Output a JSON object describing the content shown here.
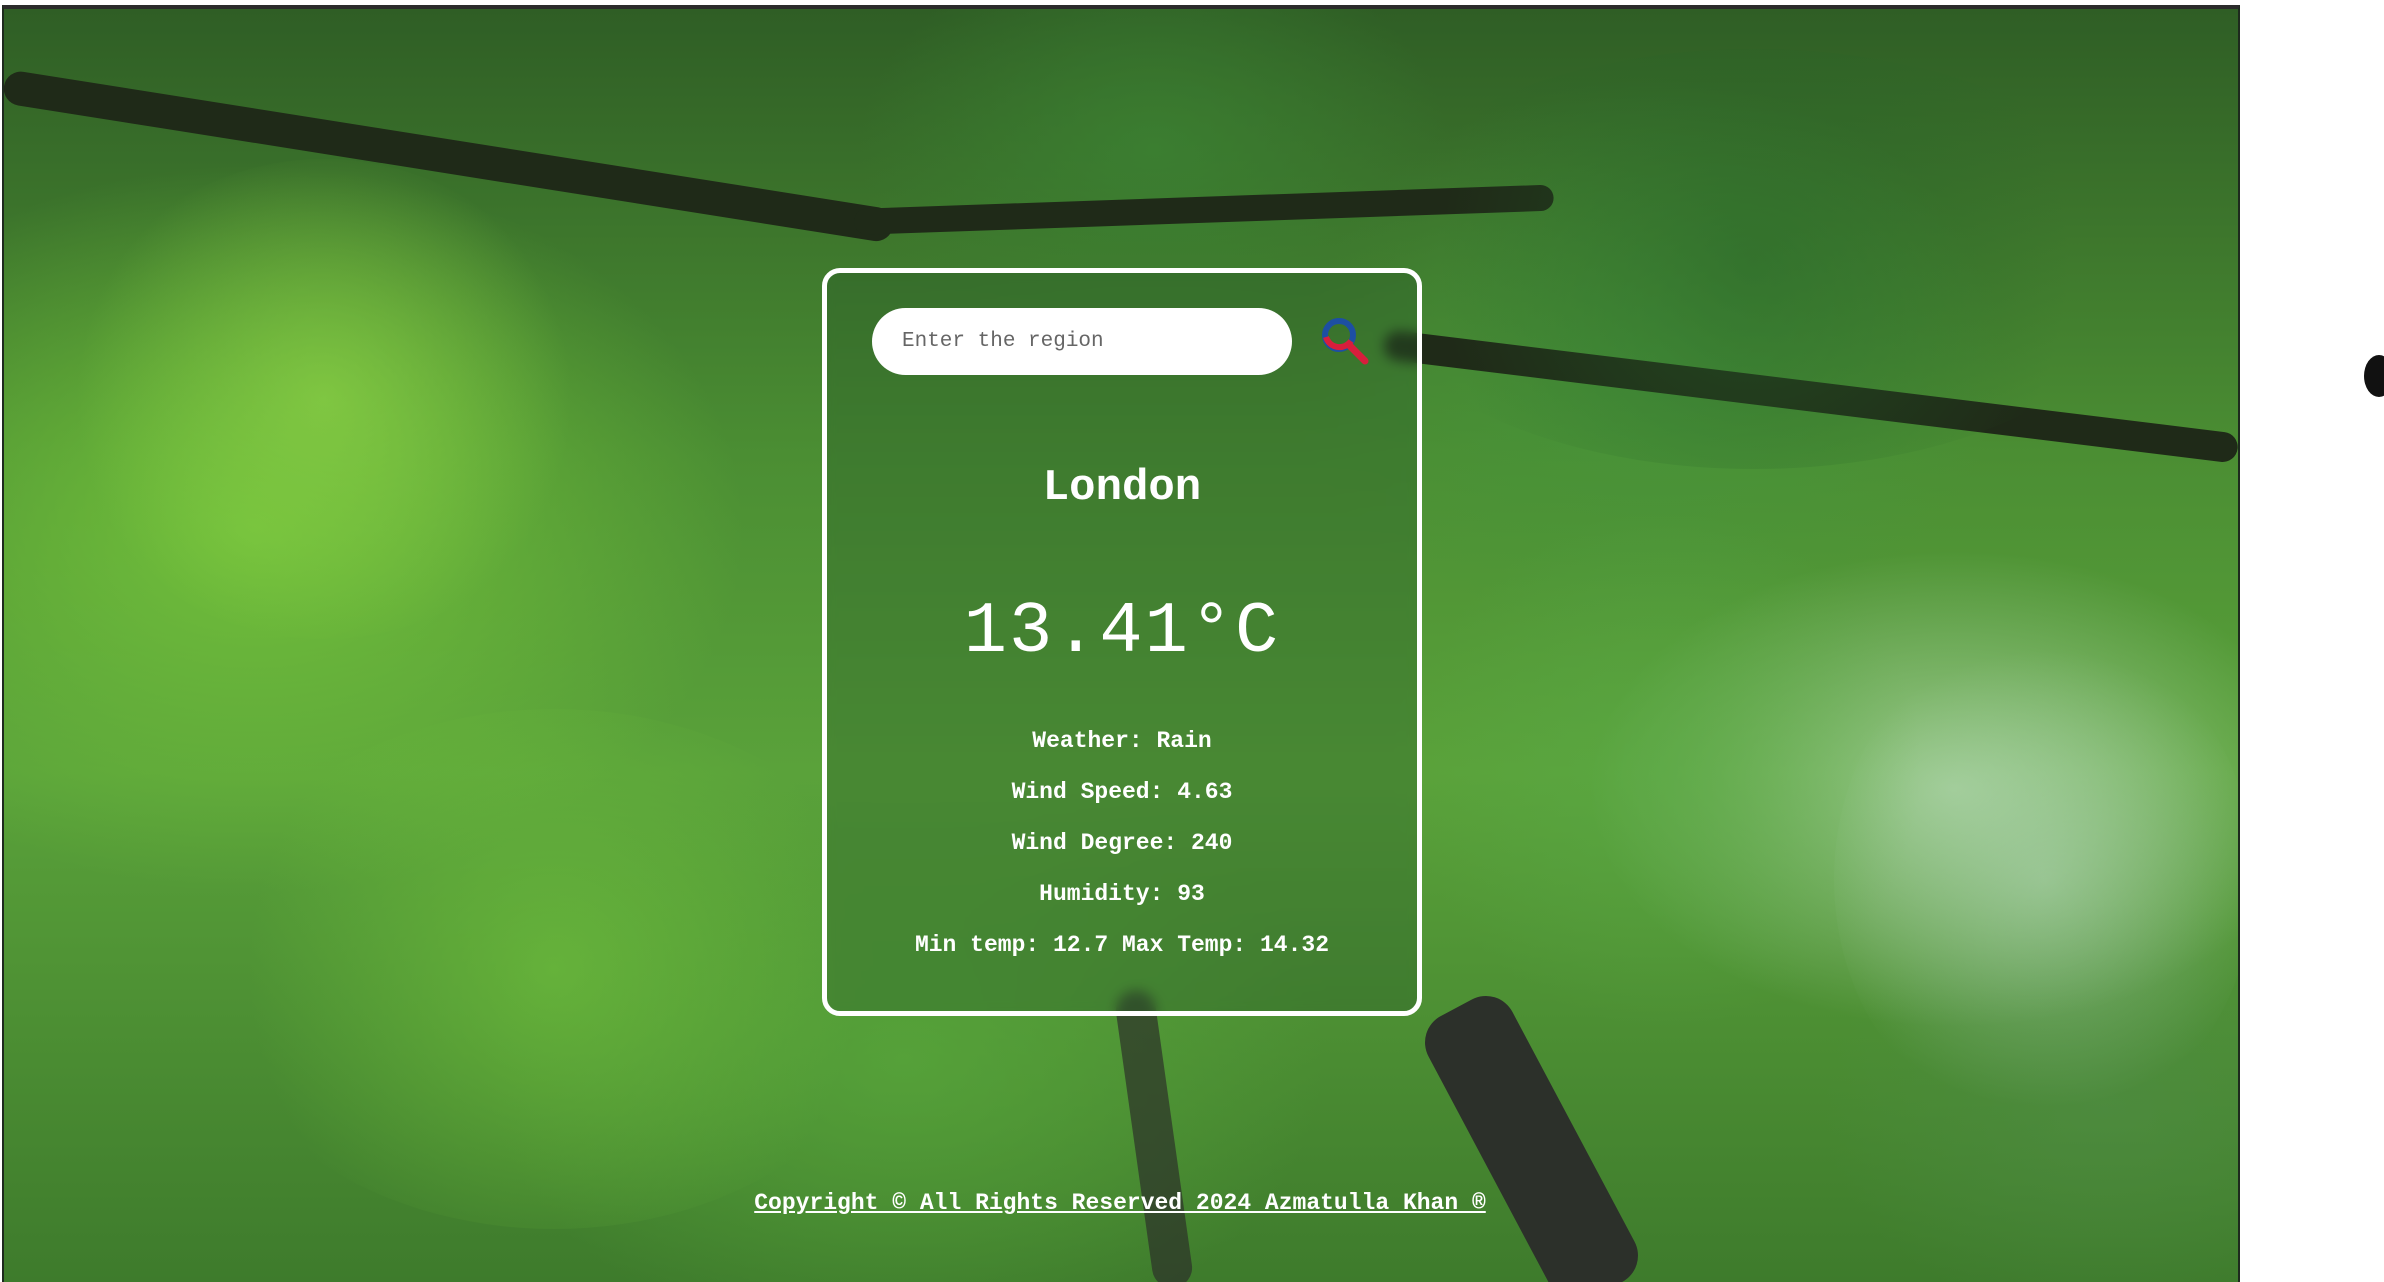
{
  "search": {
    "placeholder": "Enter the region",
    "button_icon": "search-icon",
    "icon_colors": {
      "ring": "#1d4fa3",
      "handle": "#d81e3c"
    }
  },
  "weather": {
    "city": "London",
    "temperature": "13.41°C",
    "condition": "Weather: Rain",
    "wind_speed": "Wind Speed: 4.63",
    "wind_degree": "Wind Degree: 240",
    "humidity": "Humidity: 93",
    "min_max": "Min temp: 12.7 Max Temp: 14.32"
  },
  "footer": {
    "copyright": "Copyright © All Rights Reserved 2024 Azmatulla Khan ®"
  },
  "theme": {
    "card_border": "#ffffff",
    "text": "#ffffff",
    "background": "forest-rain"
  }
}
